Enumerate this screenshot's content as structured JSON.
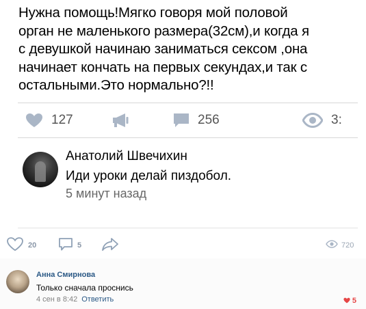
{
  "post": {
    "text": "Нужна помощь!Мягко говоря мой половой\nорган не маленького размера(32см),и когда я\nс девушкой начинаю заниматься сексом ,она\nначинает кончать на первых секундах,и так с\nостальными.Это нормально?!!",
    "stats": {
      "likes": "127",
      "comments": "256",
      "views": "3:"
    }
  },
  "comment1": {
    "author": "Анатолий Швечихин",
    "text": "Иди уроки делай пиздобол.",
    "time": "5 минут назад"
  },
  "actions": {
    "likes": "20",
    "comments": "5",
    "views": "720"
  },
  "comment2": {
    "author": "Анна Смирнова",
    "text": "Только сначала проснись",
    "time": "4 сен в 8:42",
    "reply_label": "Ответить",
    "likes": "5"
  },
  "colors": {
    "icon_gray": "#aab6c6",
    "link_blue": "#2a5885",
    "like_red": "#e64646"
  }
}
